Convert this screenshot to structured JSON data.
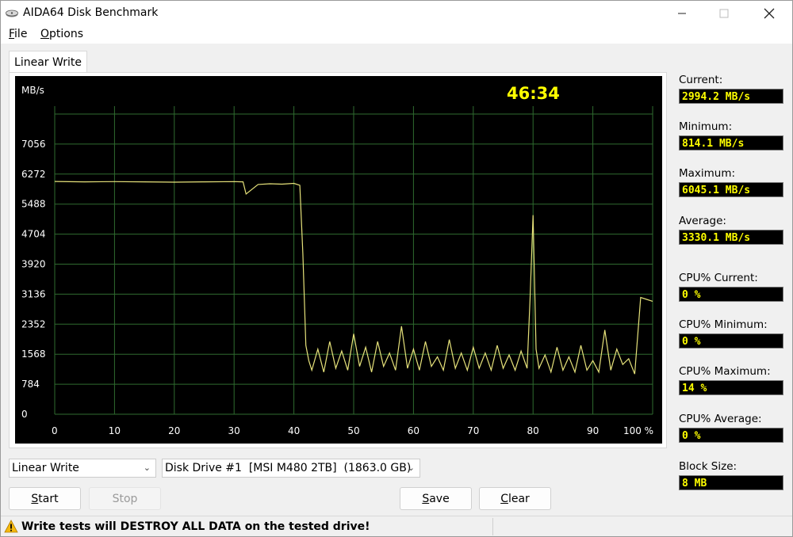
{
  "window": {
    "title": "AIDA64 Disk Benchmark",
    "minimize_icon": "minimize-icon",
    "maximize_icon": "maximize-icon",
    "close_icon": "close-icon"
  },
  "menu": [
    {
      "label_underlined": "F",
      "label_rest": "ile"
    },
    {
      "label_underlined": "O",
      "label_rest": "ptions"
    }
  ],
  "tab": {
    "label": "Linear Write"
  },
  "chart_data": {
    "type": "line",
    "ylabel": "MB/s",
    "xlabel": "",
    "ylim": [
      0,
      7840
    ],
    "xlim": [
      0,
      100
    ],
    "y_ticks": [
      "7056",
      "6272",
      "5488",
      "4704",
      "3920",
      "3136",
      "2352",
      "1568",
      "784",
      "0"
    ],
    "x_ticks": [
      "0",
      "10",
      "20",
      "30",
      "40",
      "50",
      "60",
      "70",
      "80",
      "90",
      "100 %"
    ],
    "elapsed_time": "46:34",
    "line_color": "#e6e27a",
    "background": "#000000",
    "grid": true,
    "series": [
      {
        "x": [
          0,
          5,
          10,
          15,
          20,
          25,
          30,
          31.5,
          32,
          34,
          36,
          38,
          40,
          41,
          41.5,
          42,
          42.5,
          43,
          44,
          45,
          46,
          47,
          48,
          49,
          50,
          51,
          52,
          53,
          54,
          55,
          56,
          57,
          58,
          59,
          60,
          61,
          62,
          63,
          64,
          65,
          66,
          67,
          68,
          69,
          70,
          71,
          72,
          73,
          74,
          75,
          76,
          77,
          78,
          79,
          79.5,
          80,
          80.5,
          81,
          82,
          83,
          84,
          85,
          86,
          87,
          88,
          89,
          90,
          91,
          92,
          93,
          94,
          95,
          96,
          97,
          98,
          99,
          100
        ],
        "values": [
          6080,
          6070,
          6075,
          6070,
          6060,
          6070,
          6075,
          6070,
          5750,
          6000,
          6020,
          6010,
          6030,
          5980,
          4200,
          1800,
          1400,
          1150,
          1700,
          1100,
          1900,
          1200,
          1650,
          1150,
          2100,
          1250,
          1750,
          1100,
          1900,
          1250,
          1600,
          1150,
          2300,
          1200,
          1700,
          1150,
          1900,
          1250,
          1500,
          1150,
          1950,
          1200,
          1600,
          1150,
          1750,
          1200,
          1600,
          1150,
          1800,
          1200,
          1550,
          1150,
          1650,
          1200,
          3000,
          5200,
          1700,
          1200,
          1550,
          1100,
          1750,
          1150,
          1500,
          1100,
          1800,
          1150,
          1400,
          1100,
          2200,
          1150,
          1700,
          1300,
          1450,
          1050,
          3050,
          3000,
          2950
        ]
      }
    ]
  },
  "stats": [
    {
      "label": "Current:",
      "value": "2994.2 MB/s"
    },
    {
      "label": "Minimum:",
      "value": "814.1 MB/s"
    },
    {
      "label": "Maximum:",
      "value": "6045.1 MB/s"
    },
    {
      "label": "Average:",
      "value": "3330.1 MB/s"
    },
    {
      "label": "CPU% Current:",
      "value": "0 %"
    },
    {
      "label": "CPU% Minimum:",
      "value": "0 %"
    },
    {
      "label": "CPU% Maximum:",
      "value": "14 %"
    },
    {
      "label": "CPU% Average:",
      "value": "0 %"
    },
    {
      "label": "Block Size:",
      "value": "8 MB"
    }
  ],
  "controls": {
    "test_select": "Linear Write",
    "drive_select": "Disk Drive #1  [MSI M480 2TB]  (1863.0 GB)",
    "start": {
      "u": "S",
      "rest": "tart"
    },
    "stop": "Stop",
    "save": {
      "u": "S",
      "rest": "ave"
    },
    "clear": {
      "u": "C",
      "rest": "lear"
    }
  },
  "status": {
    "warning": "Write tests will DESTROY ALL DATA on the tested drive!",
    "warning_icon": "warning-icon"
  }
}
